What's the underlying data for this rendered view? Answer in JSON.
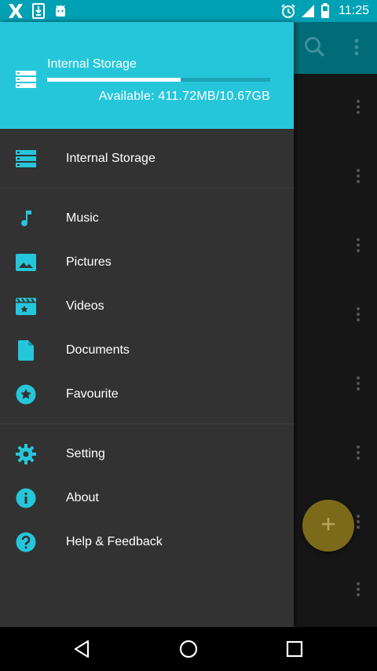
{
  "status_bar": {
    "time": "11:25",
    "icons": [
      "x-app-icon",
      "download-icon",
      "android-icon",
      "alarm-icon",
      "signal-icon",
      "battery-icon"
    ]
  },
  "app_bar": {
    "icons": [
      "search-icon",
      "more-vert-icon"
    ]
  },
  "drawer": {
    "header": {
      "title": "Internal Storage",
      "available": "Available:  411.72MB/10.67GB",
      "progress_used": 0.6,
      "icon": "storage-icon"
    },
    "items": [
      {
        "label": "Internal Storage",
        "icon": "storage-icon"
      },
      {
        "label": "Music",
        "icon": "music-note-icon"
      },
      {
        "label": "Pictures",
        "icon": "image-icon"
      },
      {
        "label": "Videos",
        "icon": "movie-icon"
      },
      {
        "label": "Documents",
        "icon": "document-icon"
      },
      {
        "label": "Favourite",
        "icon": "star-icon"
      },
      {
        "label": "Setting",
        "icon": "gear-icon"
      },
      {
        "label": "About",
        "icon": "info-icon"
      },
      {
        "label": "Help & Feedback",
        "icon": "help-icon"
      }
    ]
  },
  "fab": {
    "icon": "add-icon"
  },
  "nav_bar": {
    "icons": [
      "back-icon",
      "home-icon",
      "recents-icon"
    ]
  },
  "colors": {
    "accent": "#26c6da",
    "status_bar": "#00a1b4",
    "app_bar": "#006c78",
    "drawer_bg": "#323232",
    "fab": "#7c6a1b"
  }
}
